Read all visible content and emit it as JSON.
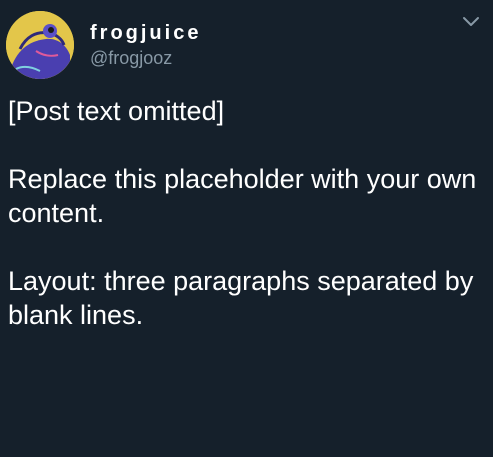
{
  "tweet": {
    "display_name": "frogjuice",
    "handle": "@frogjooz",
    "paragraphs": [
      "[Post text omitted]",
      "Replace this placeholder with your own content.",
      "Layout: three paragraphs separated by blank lines."
    ]
  },
  "icons": {
    "avatar": "frog-avatar",
    "menu": "chevron-down-icon"
  },
  "colors": {
    "background": "#15202b",
    "text": "#ffffff",
    "secondary_text": "#8899a6",
    "avatar_background": "#e3c64a",
    "avatar_frog": "#4a3fb0"
  }
}
